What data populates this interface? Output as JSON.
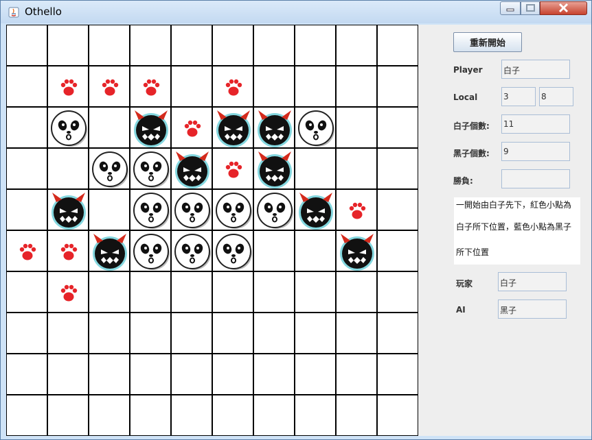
{
  "window": {
    "title": "Othello"
  },
  "board": {
    "rows": [
      "..........",
      ".hhh.h....",
      ".W.BhBBW..",
      "..WWBhB...",
      ".B.WWWWBh.",
      "hhBWWW..B.",
      ".h........",
      "..........",
      "..........",
      ".........."
    ],
    "legend": {
      "W": "white-piece",
      "B": "black-piece",
      "h": "move-hint"
    }
  },
  "sidebar": {
    "restart_label": "重新開始",
    "player_label": "Player",
    "player_value": "白子",
    "local_label": "Local",
    "local_x": "3",
    "local_y": "8",
    "white_count_label": "白子個數:",
    "white_count": "11",
    "black_count_label": "黑子個數:",
    "black_count": "9",
    "winner_label": "勝負:",
    "winner_value": "",
    "info_lines": [
      "一開始由白子先下，紅色小點為",
      "白子所下位置，藍色小點為黑子",
      "所下位置"
    ],
    "human_label": "玩家",
    "human_value": "白子",
    "ai_label": "AI",
    "ai_value": "黑子"
  },
  "colors": {
    "hint": "#e62429",
    "devil_horn": "#d42a1c",
    "devil_glow": "#1fb6c4",
    "title_bar": "#cfe3f7"
  }
}
